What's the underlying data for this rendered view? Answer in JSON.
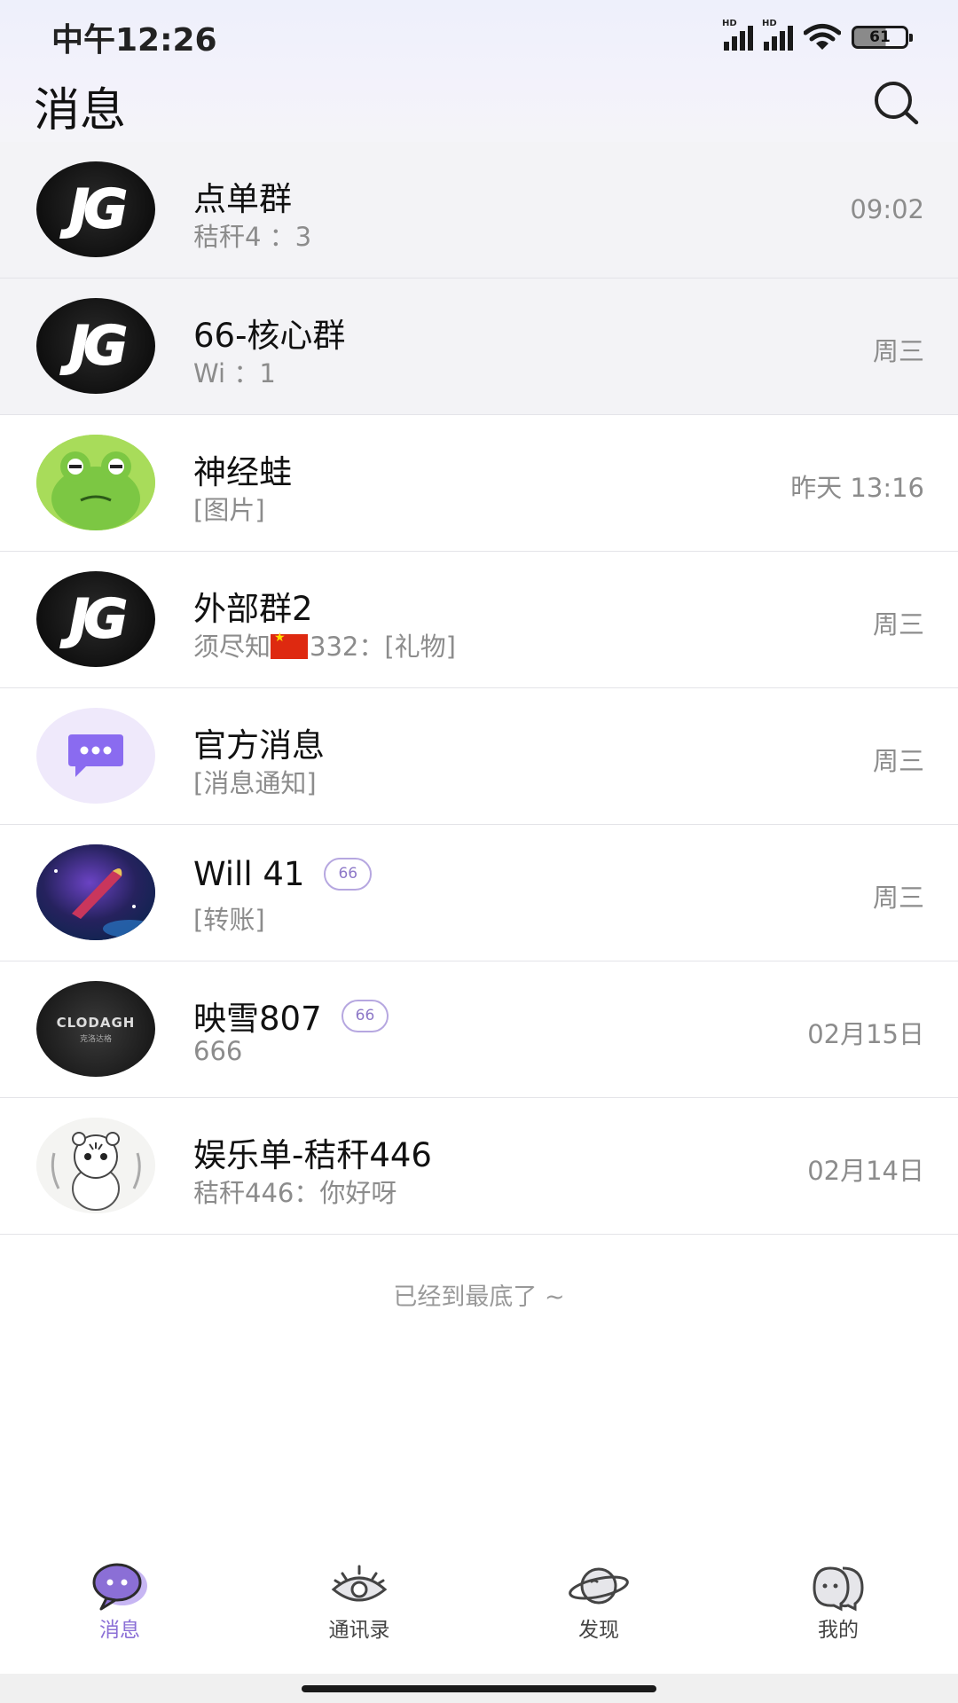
{
  "status_bar": {
    "time": "中午12:26",
    "battery": "61",
    "signal_label": "HD"
  },
  "header": {
    "title": "消息"
  },
  "conversations": [
    {
      "name": "点单群",
      "preview": "秸秆4   ：3",
      "time": "09:02",
      "pinned": true,
      "avatar": "JG"
    },
    {
      "name": "66-核心群",
      "preview": "Wi     ：1",
      "time": "周三",
      "pinned": true,
      "avatar": "JG"
    },
    {
      "name": "神经蛙",
      "preview": "[图片]",
      "time": "昨天 13:16",
      "pinned": false,
      "avatar": "frog"
    },
    {
      "name": "外部群2",
      "preview_before_flag": "须尽知",
      "preview_after_flag": "332：[礼物]",
      "time": "周三",
      "pinned": false,
      "avatar": "JG"
    },
    {
      "name": "官方消息",
      "preview": "[消息通知]",
      "time": "周三",
      "pinned": false,
      "avatar": "official"
    },
    {
      "name": "Will  41",
      "badge": "66",
      "preview": "[转账]",
      "time": "周三",
      "pinned": false,
      "avatar": "space"
    },
    {
      "name": "映雪807",
      "badge": "66",
      "preview": "666",
      "time": "02月15日",
      "pinned": false,
      "avatar": "car"
    },
    {
      "name": "娱乐单-秸秆446",
      "preview": "秸秆446：你好呀",
      "time": "02月14日",
      "pinned": false,
      "avatar": "tiger"
    }
  ],
  "avatar_text": {
    "jg": "JG",
    "car_brand": "CLODAGH",
    "car_sub": "克洛达格"
  },
  "list_end": "已经到最底了 ~",
  "tabs": [
    {
      "label": "消息",
      "icon": "chat-bubble-icon",
      "active": true
    },
    {
      "label": "通讯录",
      "icon": "eye-icon",
      "active": false
    },
    {
      "label": "发现",
      "icon": "planet-icon",
      "active": false
    },
    {
      "label": "我的",
      "icon": "profile-icon",
      "active": false
    }
  ],
  "colors": {
    "accent": "#8b6fd6",
    "muted": "#8c8c8c",
    "divider": "#e4e4e8"
  }
}
